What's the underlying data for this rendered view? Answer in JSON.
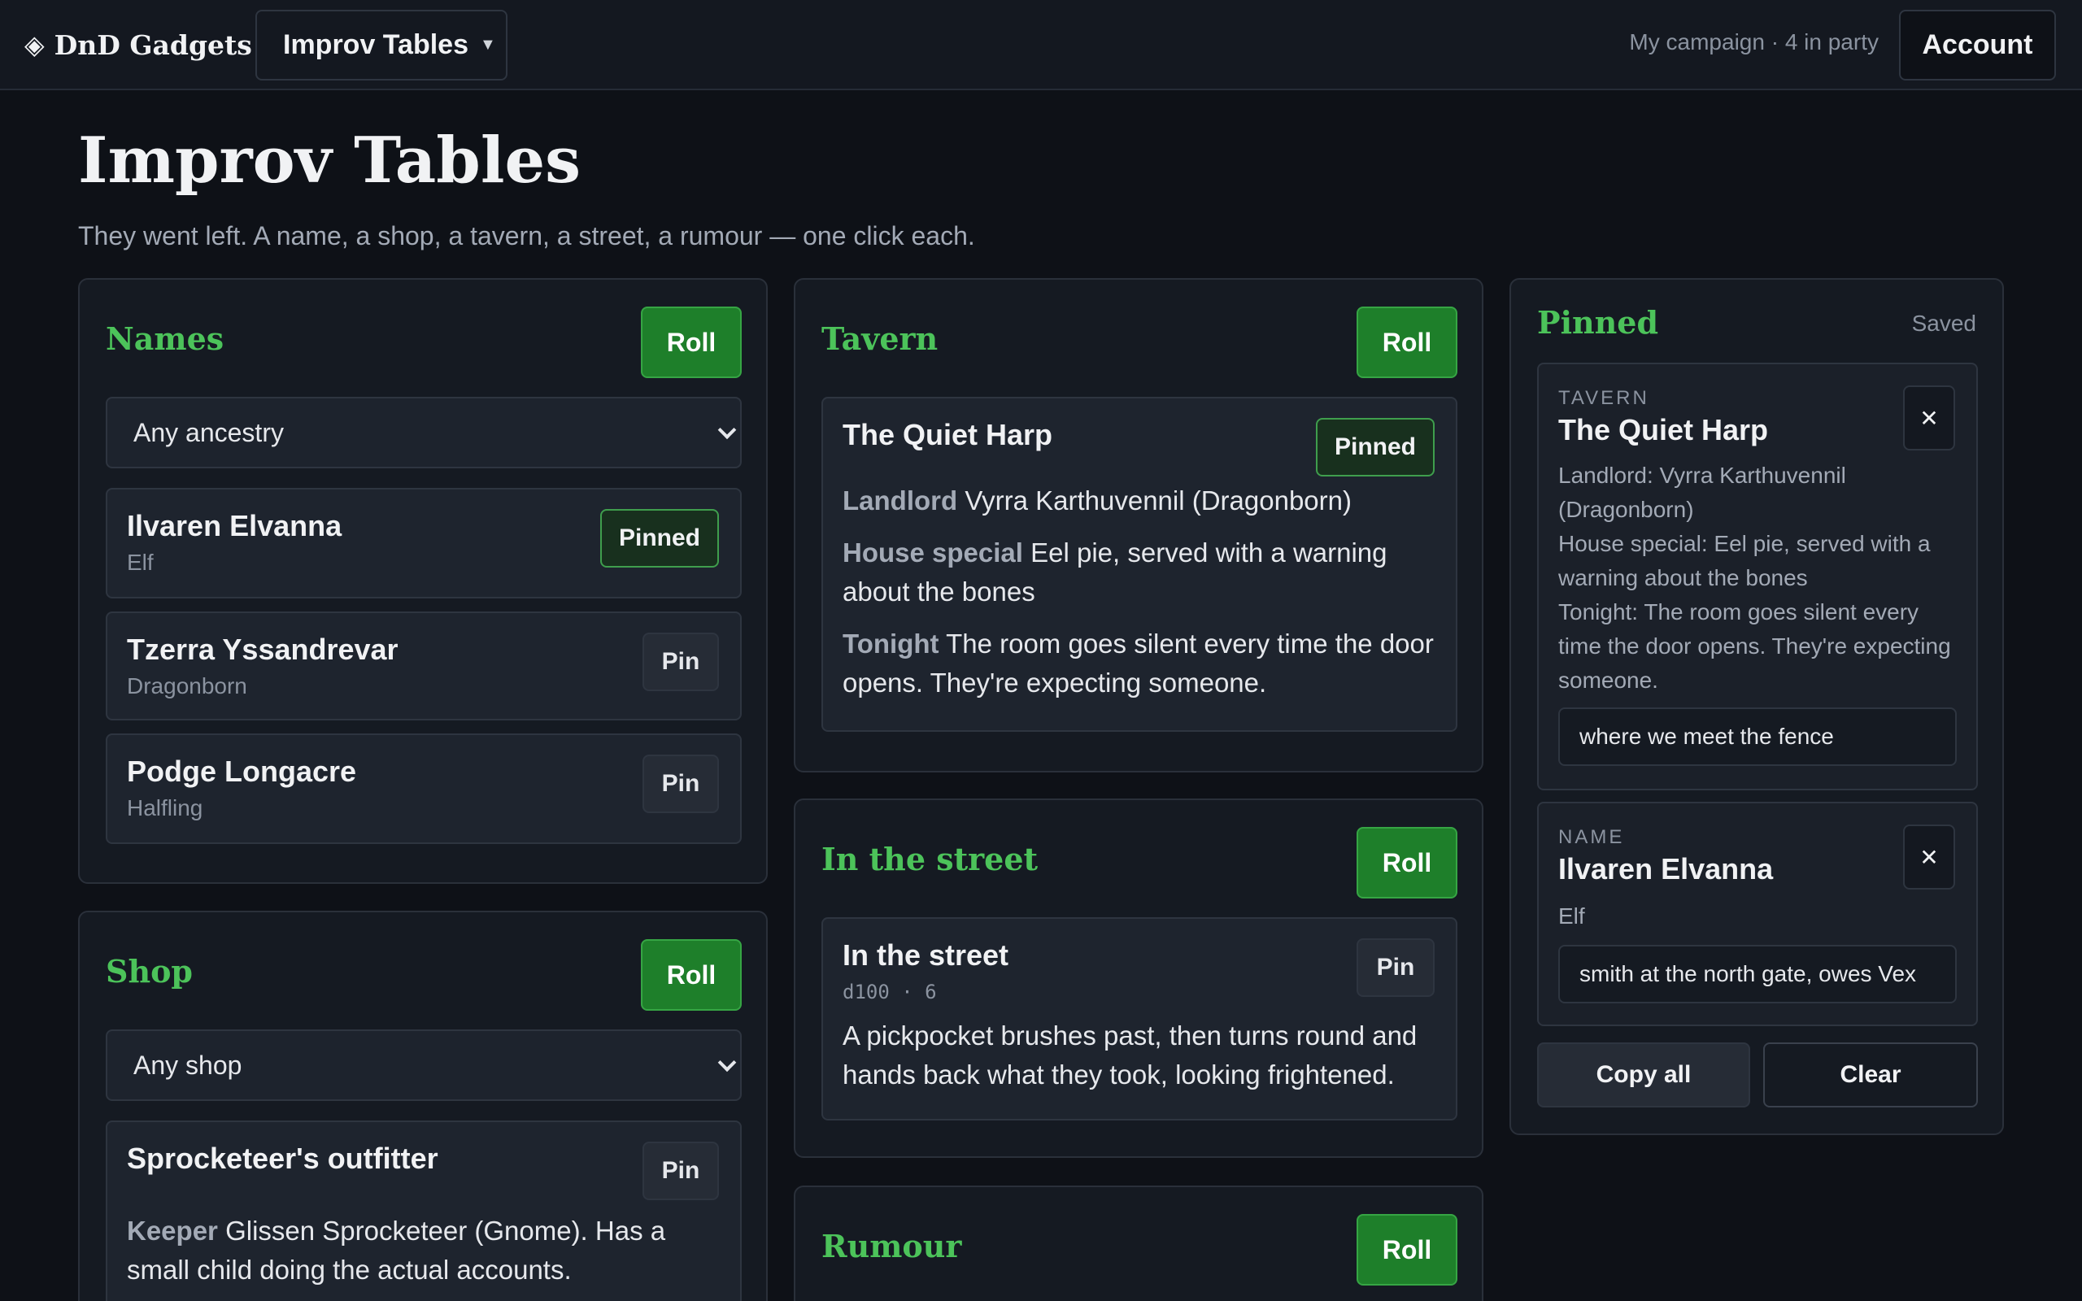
{
  "topbar": {
    "brand": "DnD Gadgets",
    "brand_icon": "◈",
    "menu_label": "Improv Tables",
    "campaign": "My campaign · 4 in party",
    "account_label": "Account"
  },
  "page": {
    "title": "Improv Tables",
    "subtitle": "They went left. A name, a shop, a tavern, a street, a rumour — one click each."
  },
  "names": {
    "title": "Names",
    "roll_label": "Roll",
    "filter": "Any ancestry",
    "items": [
      {
        "name": "Ilvaren Elvanna",
        "ancestry": "Elf",
        "pin_label": "Pinned"
      },
      {
        "name": "Tzerra Yssandrevar",
        "ancestry": "Dragonborn",
        "pin_label": "Pin"
      },
      {
        "name": "Podge Longacre",
        "ancestry": "Halfling",
        "pin_label": "Pin"
      }
    ]
  },
  "shop": {
    "title": "Shop",
    "roll_label": "Roll",
    "filter": "Any shop",
    "result": {
      "name": "Sprocketeer's outfitter",
      "pin_label": "Pin",
      "keeper_label": "Keeper",
      "keeper_text": "Glissen Sprocketeer (Gnome). Has a small child doing the actual accounts."
    }
  },
  "tavern": {
    "title": "Tavern",
    "roll_label": "Roll",
    "result": {
      "name": "The Quiet Harp",
      "pin_label": "Pinned",
      "landlord_label": "Landlord",
      "landlord_text": "Vyrra Karthuvennil (Dragonborn)",
      "special_label": "House special",
      "special_text": "Eel pie, served with a warning about the bones",
      "tonight_label": "Tonight",
      "tonight_text": "The room goes silent every time the door opens. They're expecting someone."
    }
  },
  "street": {
    "title": "In the street",
    "roll_label": "Roll",
    "result": {
      "name": "In the street",
      "roll_info": "d100 · 6",
      "pin_label": "Pin",
      "text": "A pickpocket brushes past, then turns round and hands back what they took, looking frightened."
    }
  },
  "rumour": {
    "title": "Rumour",
    "roll_label": "Roll"
  },
  "pinned": {
    "title": "Pinned",
    "status": "Saved",
    "close_glyph": "✕",
    "items": [
      {
        "kind": "TAVERN",
        "title": "The Quiet Harp",
        "lines": [
          "Landlord: Vyrra Karthuvennil (Dragonborn)",
          "House special: Eel pie, served with a warning about the bones",
          "Tonight: The room goes silent every time the door opens. They're expecting someone."
        ],
        "note": "where we meet the fence"
      },
      {
        "kind": "NAME",
        "title": "Ilvaren Elvanna",
        "lines": [
          "Elf"
        ],
        "note": "smith at the north gate, owes Vex"
      }
    ],
    "copy_label": "Copy all",
    "clear_label": "Clear"
  },
  "colors": {
    "accent": "#4cc35a",
    "roll_button": "#1e7f2a",
    "background": "#0e1117",
    "card": "#151a22"
  },
  "icons": {
    "brand": "diamond-icon",
    "menu": "caret-down-icon",
    "select": "chevron-down-icon",
    "remove": "close-icon"
  }
}
